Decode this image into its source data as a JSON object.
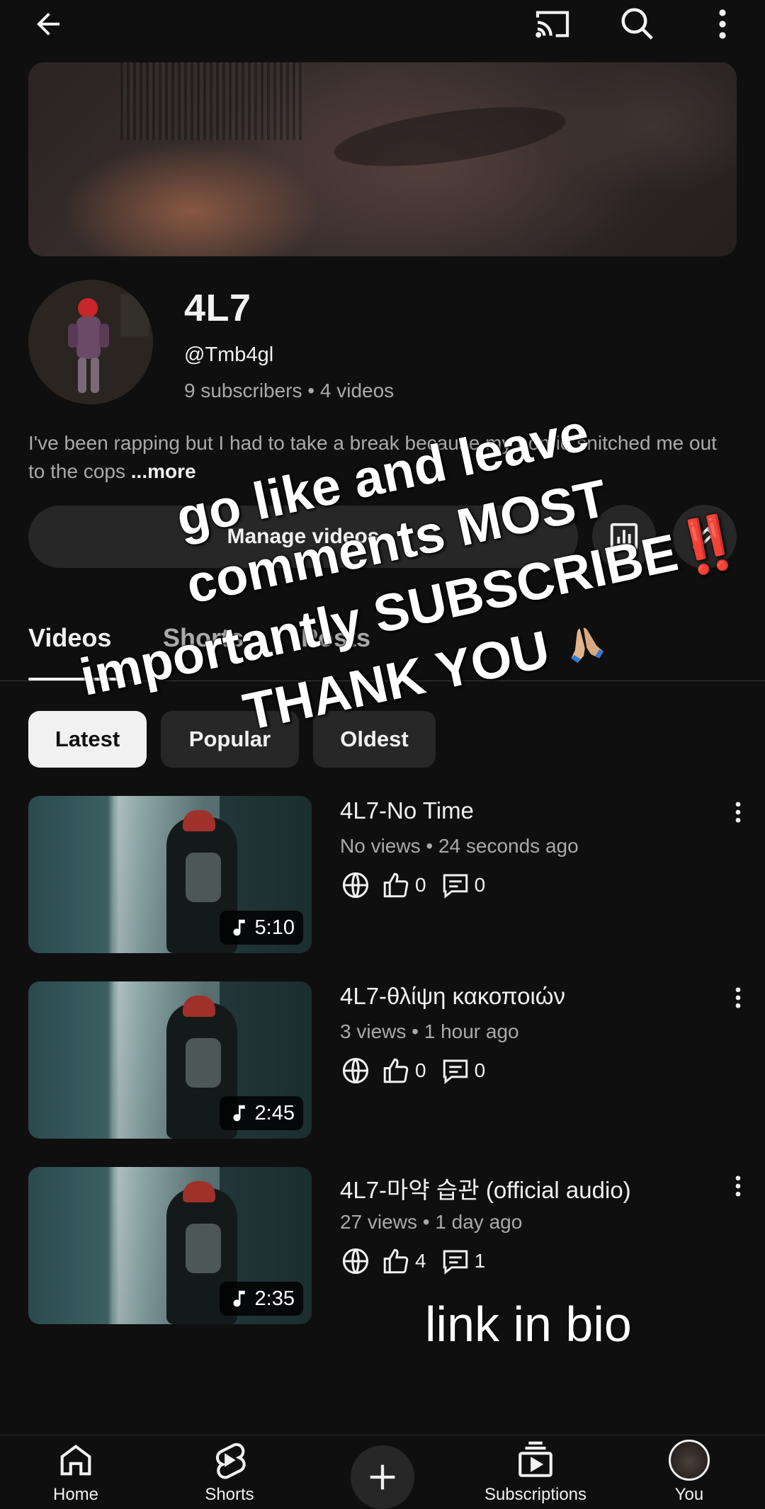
{
  "topbar": {
    "back": "arrow-left-icon",
    "cast": "cast-icon",
    "search": "search-icon",
    "more": "more-vert-icon"
  },
  "channel": {
    "name": "4L7",
    "handle": "@Tmb4gl",
    "stats": "9 subscribers • 4 videos",
    "description": "I've been rapping but I had to take a break because my homie snitched me out to the cops",
    "more_label": "...more",
    "manage_label": "Manage videos"
  },
  "tabs": [
    {
      "label": "Videos"
    },
    {
      "label": "Shorts"
    },
    {
      "label": "Posts"
    }
  ],
  "chips": [
    {
      "label": "Latest"
    },
    {
      "label": "Popular"
    },
    {
      "label": "Oldest"
    }
  ],
  "videos": [
    {
      "title": "4L7-No Time",
      "meta": "No views • 24 seconds ago",
      "likes": "0",
      "comments": "0",
      "duration": "5:10"
    },
    {
      "title": "4L7-θλίψη κακοποιών",
      "meta": "3 views • 1 hour ago",
      "likes": "0",
      "comments": "0",
      "duration": "2:45"
    },
    {
      "title": "4L7-마약 습관 (official audio)",
      "meta": "27 views • 1 day ago",
      "likes": "4",
      "comments": "1",
      "duration": "2:35"
    }
  ],
  "overlay": {
    "line1": "go like and leave",
    "line2": "comments MOST",
    "line3": "importantly SUBSCRIBE‼️",
    "line4": "THANK YOU",
    "emoji": "praying-hands-icon",
    "link_bio": "link in bio"
  },
  "nav": [
    {
      "label": "Home",
      "icon": "home-icon"
    },
    {
      "label": "Shorts",
      "icon": "shorts-icon"
    },
    {
      "label": "",
      "icon": "create-plus-icon"
    },
    {
      "label": "Subscriptions",
      "icon": "subscriptions-icon"
    },
    {
      "label": "You",
      "icon": "avatar"
    }
  ]
}
